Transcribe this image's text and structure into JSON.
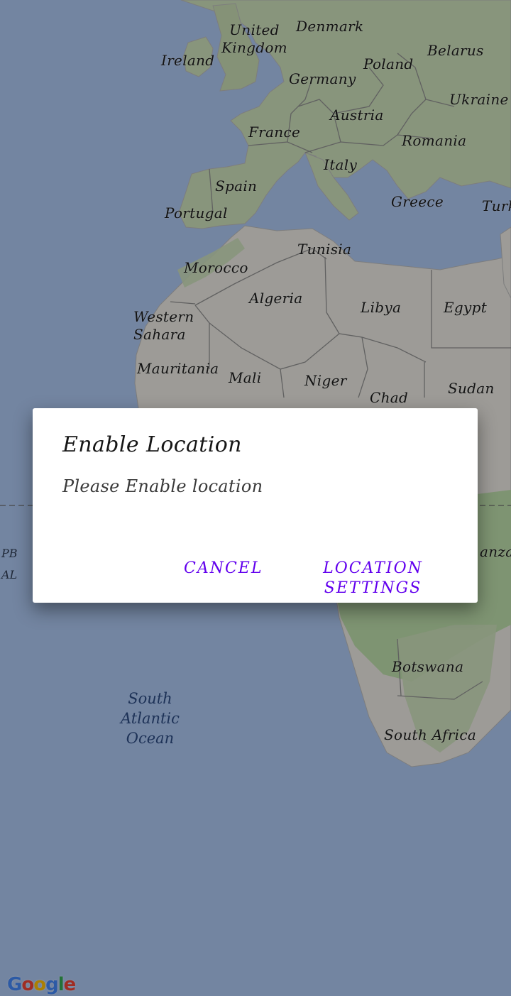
{
  "map": {
    "ocean_color": "#aac4ee",
    "land_color": "#e7e5df",
    "green_color": "#b7d9a4",
    "countries": [
      {
        "id": "ireland",
        "label": "Ireland"
      },
      {
        "id": "united-kingdom",
        "label": "United\nKingdom"
      },
      {
        "id": "denmark",
        "label": "Denmark"
      },
      {
        "id": "belarus",
        "label": "Belarus"
      },
      {
        "id": "poland",
        "label": "Poland"
      },
      {
        "id": "germany",
        "label": "Germany"
      },
      {
        "id": "ukraine",
        "label": "Ukraine"
      },
      {
        "id": "austria",
        "label": "Austria"
      },
      {
        "id": "france",
        "label": "France"
      },
      {
        "id": "romania",
        "label": "Romania"
      },
      {
        "id": "italy",
        "label": "Italy"
      },
      {
        "id": "spain",
        "label": "Spain"
      },
      {
        "id": "greece",
        "label": "Greece"
      },
      {
        "id": "turkey",
        "label": "Turk"
      },
      {
        "id": "portugal",
        "label": "Portugal"
      },
      {
        "id": "tunisia",
        "label": "Tunisia"
      },
      {
        "id": "morocco",
        "label": "Morocco"
      },
      {
        "id": "algeria",
        "label": "Algeria"
      },
      {
        "id": "libya",
        "label": "Libya"
      },
      {
        "id": "egypt",
        "label": "Egypt"
      },
      {
        "id": "western-sahara",
        "label": "Western\nSahara"
      },
      {
        "id": "mauritania",
        "label": "Mauritania"
      },
      {
        "id": "mali",
        "label": "Mali"
      },
      {
        "id": "niger",
        "label": "Niger"
      },
      {
        "id": "chad",
        "label": "Chad"
      },
      {
        "id": "sudan",
        "label": "Sudan"
      },
      {
        "id": "tanzania",
        "label": "anza"
      },
      {
        "id": "botswana",
        "label": "Botswana"
      },
      {
        "id": "south-africa",
        "label": "South Africa"
      }
    ],
    "ocean_labels": [
      {
        "id": "south-atlantic-ocean",
        "label": "South\nAtlantic\nOcean"
      }
    ],
    "edge_labels": [
      {
        "id": "pb",
        "label": "PB"
      },
      {
        "id": "al",
        "label": "AL"
      }
    ],
    "google_logo": {
      "letters": [
        "G",
        "o",
        "o",
        "g",
        "l",
        "e"
      ],
      "colors": [
        "#4285f4",
        "#ea4335",
        "#fbbc05",
        "#4285f4",
        "#34a853",
        "#ea4335"
      ]
    }
  },
  "dialog": {
    "title": "Enable Location",
    "message": "Please Enable location",
    "cancel_label": "CANCEL",
    "settings_label": "LOCATION SETTINGS",
    "accent_color": "#6200ee"
  }
}
